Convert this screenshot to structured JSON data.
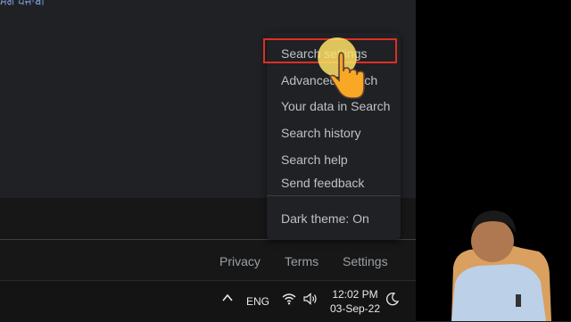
{
  "top": {
    "language_link": "ਪੰਜਾਬੀ",
    "language_partial": "ਮੰਗ"
  },
  "settings_menu": {
    "items": [
      {
        "label": "Search settings",
        "highlighted": true
      },
      {
        "label": "Advanced search",
        "highlighted": false
      },
      {
        "label": "Your data in Search",
        "highlighted": false
      },
      {
        "label": "Search history",
        "highlighted": false
      },
      {
        "label": "Search help",
        "highlighted": false
      },
      {
        "label": "Send feedback",
        "highlighted": false
      }
    ],
    "dark_theme_label": "Dark theme: On",
    "highlight_color": "#d93025"
  },
  "footer": {
    "privacy": "Privacy",
    "terms": "Terms",
    "settings": "Settings"
  },
  "taskbar": {
    "lang": "ENG",
    "time": "12:02 PM",
    "date": "03-Sep-22"
  },
  "icons": [
    "chevron-up-icon",
    "wifi-icon",
    "speaker-icon",
    "moon-icon",
    "hand-pointer-icon"
  ],
  "colors": {
    "background": "#202124",
    "footer": "#171717",
    "text": "#e8eaed",
    "link": "#8ab4f8"
  }
}
